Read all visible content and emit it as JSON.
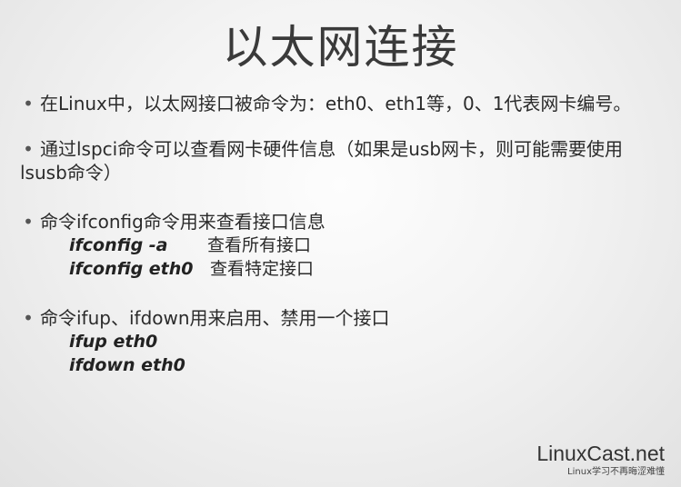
{
  "title": "以太网连接",
  "bullets": {
    "dot": "•",
    "b1": "在Linux中，以太网接口被命令为：eth0、eth1等，0、1代表网卡编号。",
    "b2_line1": "通过lspci命令可以查看网卡硬件信息（如果是usb网卡，则可能需要使用",
    "b2_line2": "lsusb命令）",
    "b3": "命令ifconfig命令用来查看接口信息",
    "b3_cmds": [
      {
        "cmd": "ifconfig -a",
        "desc": "查看所有接口"
      },
      {
        "cmd": "ifconfig  eth0",
        "desc": "查看特定接口"
      }
    ],
    "b4": "命令ifup、ifdown用来启用、禁用一个接口",
    "b4_cmds": [
      {
        "cmd": "ifup eth0"
      },
      {
        "cmd": "ifdown eth0"
      }
    ]
  },
  "logo": {
    "main": "LinuxCast.net",
    "sub": "Linux学习不再晦涩难懂"
  }
}
